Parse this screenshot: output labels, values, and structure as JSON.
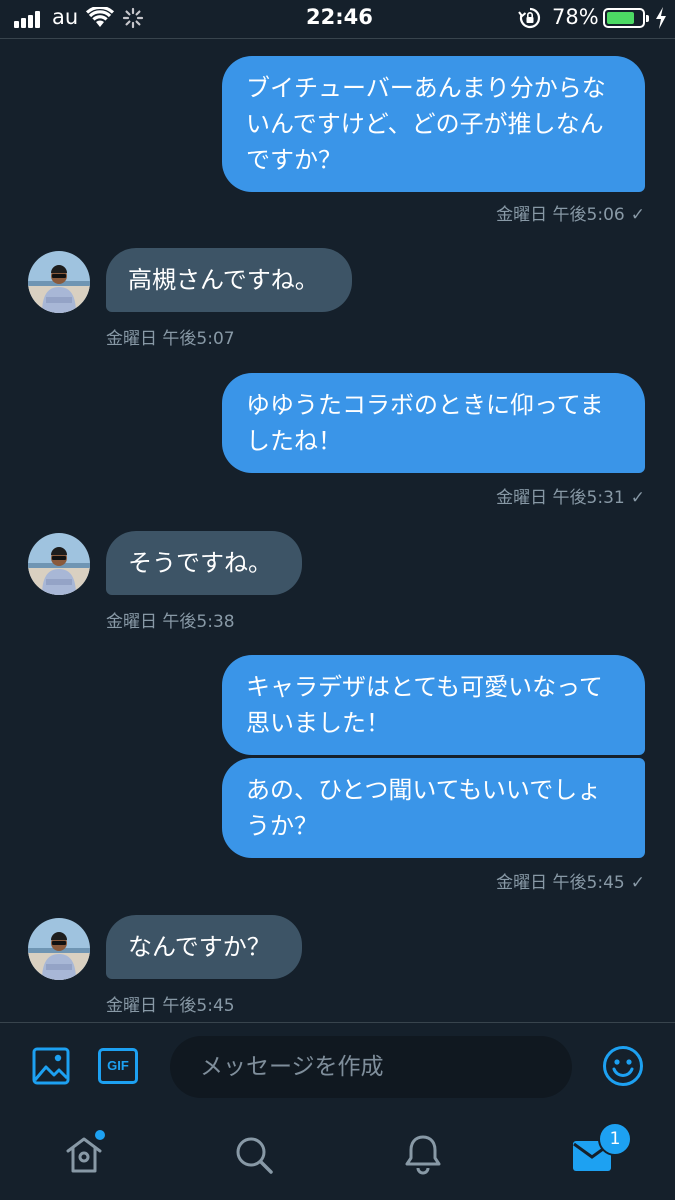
{
  "status_bar": {
    "carrier": "au",
    "time": "22:46",
    "battery_percent": "78%",
    "battery_level": 0.78,
    "icons": [
      "signal-icon",
      "wifi-icon",
      "activity-spinner-icon",
      "rotation-lock-icon",
      "battery-icon",
      "charging-bolt-icon"
    ]
  },
  "conversation": {
    "messages": [
      {
        "direction": "outgoing",
        "lines": [
          "ブイチューバーあんまり分からな",
          "いんですけど、どの子が推しなん",
          "ですか？"
        ]
      },
      {
        "direction": "incoming",
        "lines": [
          "高槻さんですね。"
        ]
      },
      {
        "direction": "outgoing",
        "lines": [
          "ゆゆうたコラボのときに仰ってま",
          "したね！"
        ]
      },
      {
        "direction": "incoming",
        "lines": [
          "そうですね。"
        ]
      },
      {
        "direction": "outgoing",
        "lines": [
          "キャラデザはとても可愛いなって",
          "思いました！"
        ]
      },
      {
        "direction": "outgoing",
        "lines": [
          "あの、ひとつ聞いてもいいでしょ",
          "うか？"
        ]
      },
      {
        "direction": "incoming",
        "lines": [
          "なんですか？"
        ]
      }
    ],
    "timestamps": [
      "金曜日 午後5:06",
      "金曜日 午後5:07",
      "金曜日 午後5:31",
      "金曜日 午後5:38",
      "金曜日 午後5:45",
      "金曜日 午後5:45"
    ],
    "read_mark": "✓"
  },
  "composer": {
    "placeholder": "メッセージを作成",
    "gif_label": "GIF",
    "icons": [
      "image-icon",
      "gif-icon",
      "emoji-icon"
    ]
  },
  "tab_bar": {
    "tabs": [
      "home",
      "search",
      "notifications",
      "messages"
    ],
    "messages_badge": "1"
  },
  "colors": {
    "background": "#15202b",
    "outgoing_bubble": "#3a95e8",
    "incoming_bubble": "#3d5466",
    "accent": "#1da1f2",
    "timestamp": "#8899a6"
  }
}
